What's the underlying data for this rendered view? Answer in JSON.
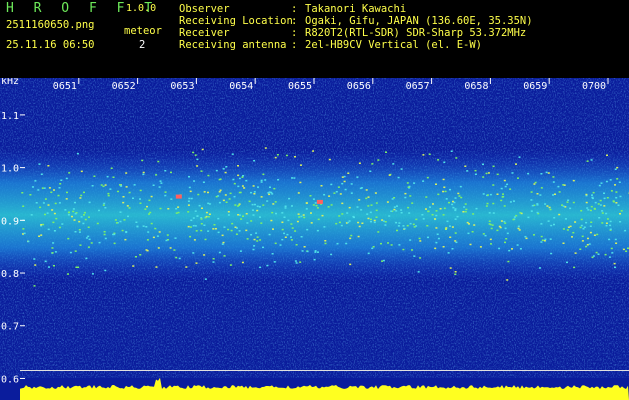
{
  "header": {
    "app_title": "H R O F F T",
    "app_version": "1.0.0",
    "file_name": "2511160650.png",
    "timestamp": "25.11.16 06:50",
    "meteor_label": "meteor",
    "meteor_count": "2"
  },
  "station_info": [
    {
      "label": "Observer",
      "value": "Takanori Kawachi"
    },
    {
      "label": "Receiving Location",
      "value": "Ogaki, Gifu, JAPAN (136.60E, 35.35N)"
    },
    {
      "label": "Receiver",
      "value": "R820T2(RTL-SDR) SDR-Sharp 53.372MHz"
    },
    {
      "label": "Receiving antenna",
      "value": "2el-HB9CV Vertical (el. E-W)"
    }
  ],
  "colors": {
    "header_green": "#6eea5a",
    "header_yellow": "#ffff4a",
    "background_blue": "#0a1c9c",
    "signal_band": "#33c8d8",
    "echo_green": "#7af06a",
    "power_trace": "#ffff20",
    "cursor_line": "#ffffff"
  },
  "chart_data": {
    "type": "heatmap",
    "ylabel": "kHz",
    "y_ticks": [
      "1.1",
      "1.0",
      "0.9",
      "0.8",
      "0.7",
      "0.6"
    ],
    "ylim": [
      0.58,
      1.17
    ],
    "x_ticks": [
      "0651",
      "0652",
      "0653",
      "0654",
      "0655",
      "0656",
      "0657",
      "0658",
      "0659",
      "0700"
    ],
    "xlim": [
      650,
      700
    ],
    "signal_band_khz": [
      0.82,
      1.0
    ],
    "signal_center_khz": 0.915,
    "cursor_khz": 0.615,
    "meteor_echoes": [
      {
        "time": "0652.7",
        "freq_khz": 0.945
      },
      {
        "time": "0655.1",
        "freq_khz": 0.935
      }
    ],
    "grid": false,
    "legend": "none"
  }
}
